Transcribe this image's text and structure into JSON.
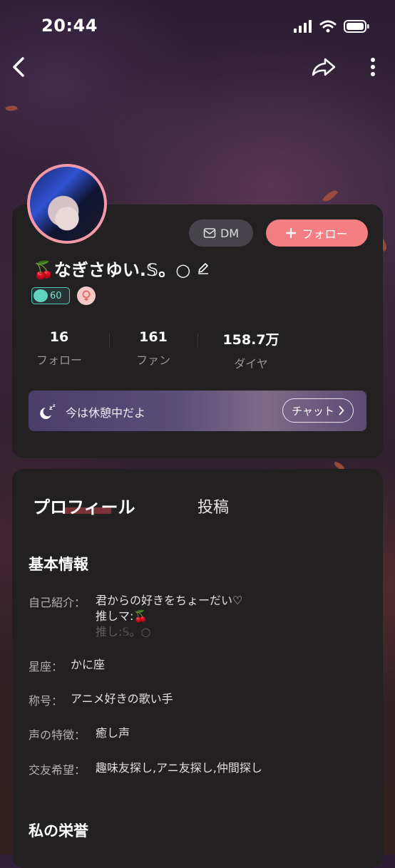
{
  "status_bar": {
    "time": "20:44"
  },
  "header": {
    "back_icon": "chevron-left-icon",
    "share_icon": "share-arrow-icon",
    "more_icon": "more-vertical-icon"
  },
  "profile": {
    "name": "🍒なぎさゆい.𝕊。○",
    "level": "60",
    "dm_label": "DM",
    "follow_label": "フォロー",
    "stats": [
      {
        "value": "16",
        "label": "フォロー"
      },
      {
        "value": "161",
        "label": "ファン"
      },
      {
        "value": "158.7万",
        "label": "ダイヤ"
      }
    ],
    "status_text": "今は休憩中だよ",
    "chat_label": "チャット"
  },
  "tabs": [
    {
      "label": "プロフィール",
      "active": true
    },
    {
      "label": "投稿",
      "active": false
    }
  ],
  "basic_info": {
    "title": "基本情報",
    "intro_label": "自己紹介：",
    "intro_lines": [
      "君からの好きをちょーだい♡",
      "推しマ:🍒",
      "推し:𝕊。○"
    ],
    "rows": [
      {
        "label": "星座：",
        "value": "かに座"
      },
      {
        "label": "称号：",
        "value": "アニメ好きの歌い手"
      },
      {
        "label": "声の特徴：",
        "value": "癒し声"
      },
      {
        "label": "交友希望：",
        "value": "趣味友探し,アニ友探し,仲間探し"
      }
    ]
  },
  "honors": {
    "title": "私の栄誉"
  },
  "colors": {
    "accent": "#f47f82",
    "card": "#232022",
    "level": "#53c8b5"
  }
}
